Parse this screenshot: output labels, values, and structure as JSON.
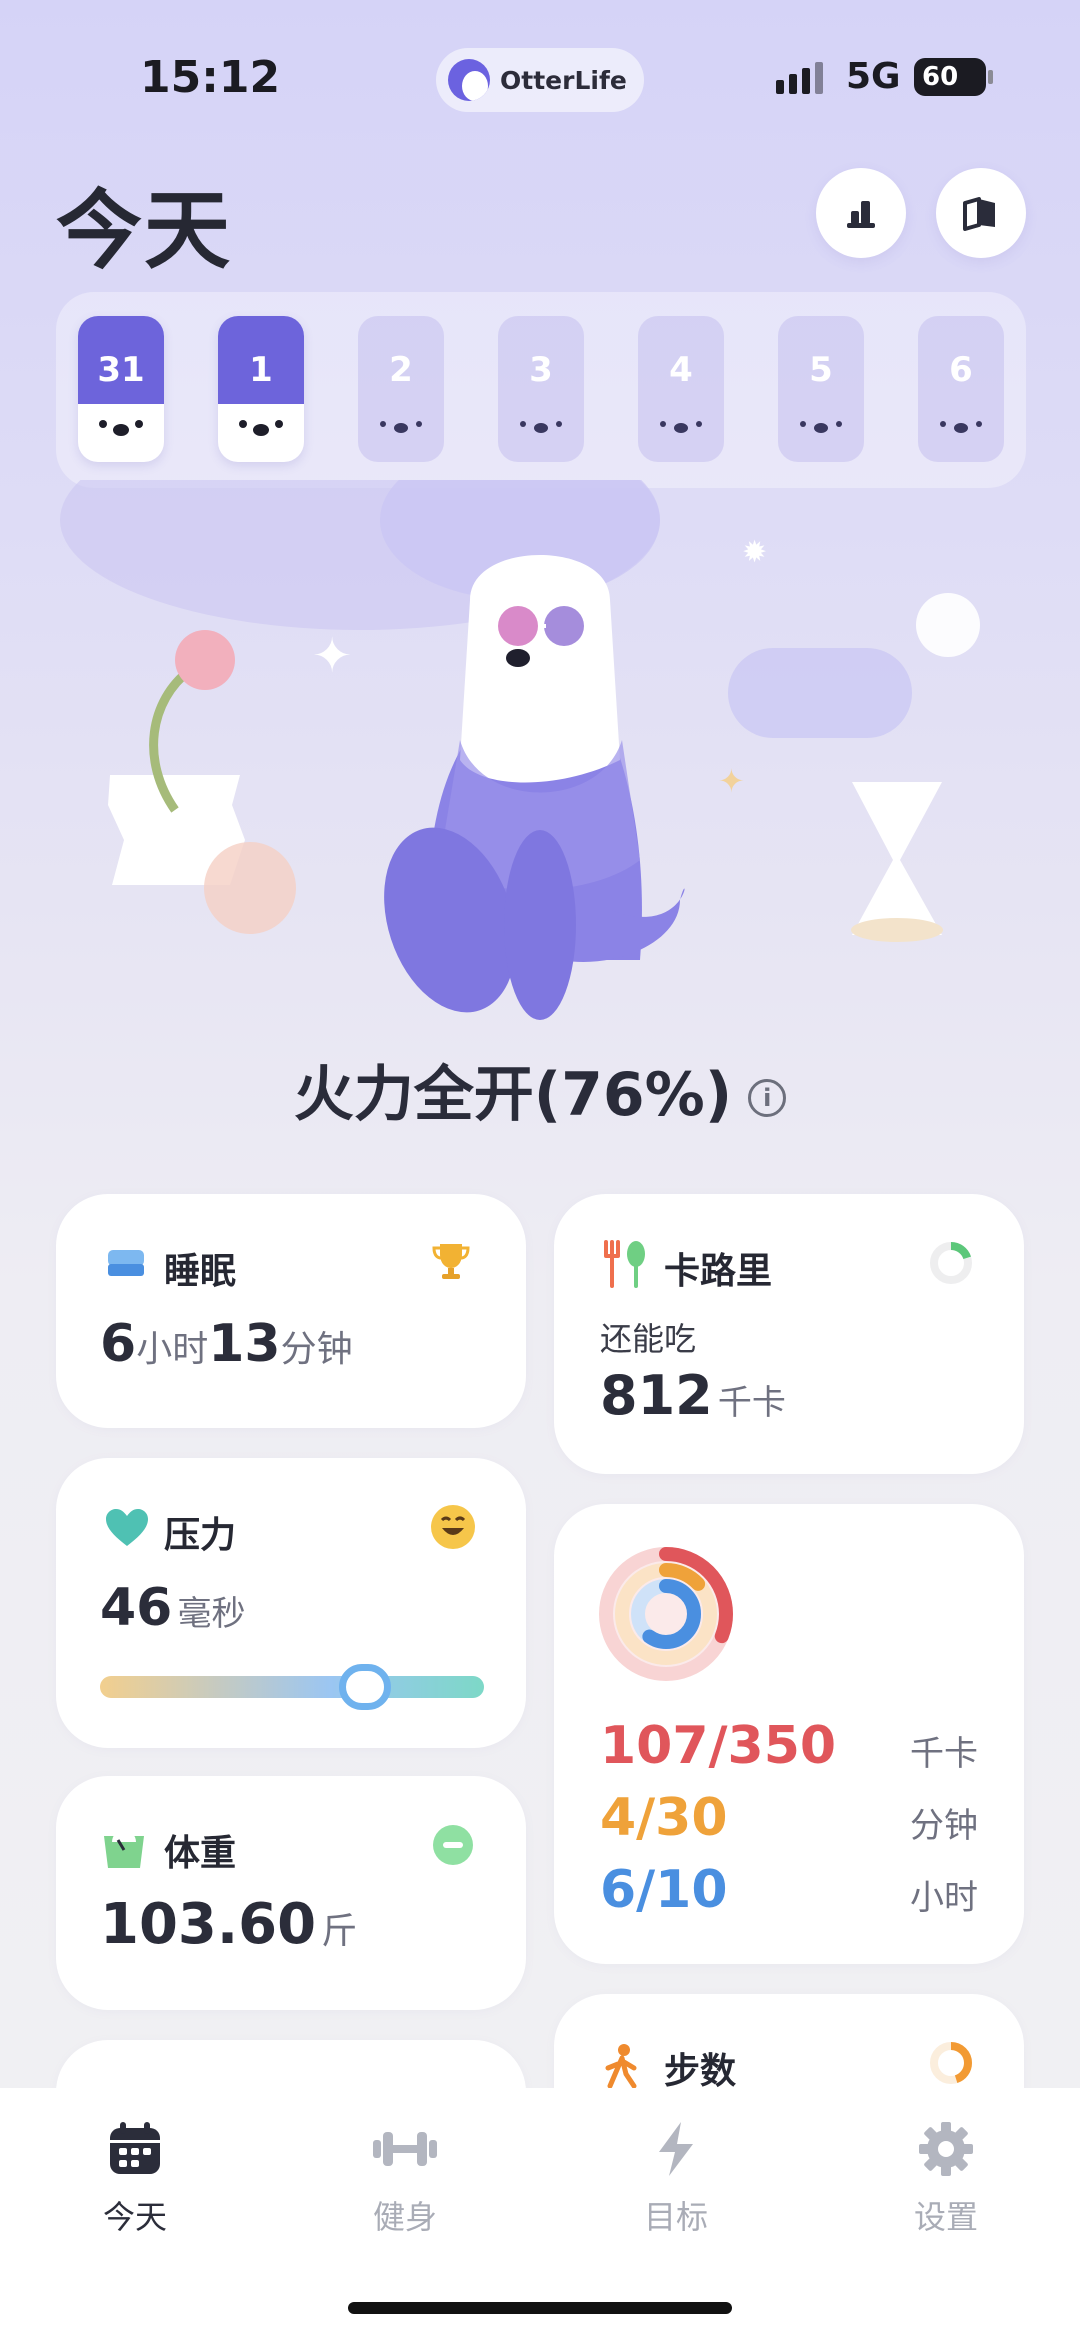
{
  "status_bar": {
    "time": "15:12",
    "app_name": "OtterLife",
    "network": "5G",
    "battery": "60"
  },
  "header": {
    "title": "今天",
    "stats_icon": "bar-chart-icon",
    "book_icon": "book-icon"
  },
  "calendar": {
    "days": [
      {
        "num": "31",
        "state": "done"
      },
      {
        "num": "1",
        "state": "today"
      },
      {
        "num": "2",
        "state": "future"
      },
      {
        "num": "3",
        "state": "future"
      },
      {
        "num": "4",
        "state": "future"
      },
      {
        "num": "5",
        "state": "future"
      },
      {
        "num": "6",
        "state": "future"
      }
    ]
  },
  "mood": {
    "text": "火力全开(76%)",
    "value_percent": 76
  },
  "cards": {
    "sleep": {
      "title": "睡眠",
      "hours": "6",
      "hours_unit": "小时",
      "minutes": "13",
      "minutes_unit": "分钟",
      "badge_icon": "trophy-icon"
    },
    "stress": {
      "title": "压力",
      "value": "46",
      "unit": "毫秒",
      "slider_fraction": 0.69,
      "face_icon": "smile-face-icon"
    },
    "weight": {
      "title": "体重",
      "value": "103.60",
      "unit": "斤",
      "trend_icon": "minus-icon"
    },
    "calories": {
      "title": "卡路里",
      "sub_label": "还能吃",
      "value": "812",
      "unit": "千卡",
      "ring_fraction": 0.2
    },
    "activity": {
      "rows": [
        {
          "value": "107/350",
          "unit": "千卡",
          "color": "#e0565b",
          "fraction": 0.31
        },
        {
          "value": "4/30",
          "unit": "分钟",
          "color": "#efa23a",
          "fraction": 0.13
        },
        {
          "value": "6/10",
          "unit": "小时",
          "color": "#4a8fe0",
          "fraction": 0.6
        }
      ]
    },
    "steps": {
      "title": "步数",
      "ring_fraction": 0.45
    }
  },
  "tabbar": {
    "tabs": [
      {
        "label": "今天",
        "icon": "calendar-icon",
        "active": true
      },
      {
        "label": "健身",
        "icon": "dumbbell-icon",
        "active": false
      },
      {
        "label": "目标",
        "icon": "lightning-icon",
        "active": false
      },
      {
        "label": "设置",
        "icon": "gear-icon",
        "active": false
      }
    ]
  },
  "colors": {
    "accent": "#6d64db",
    "red": "#e0565b",
    "orange": "#efa23a",
    "blue": "#4a8fe0",
    "green": "#5cc77a",
    "teal": "#4fc1b3"
  }
}
